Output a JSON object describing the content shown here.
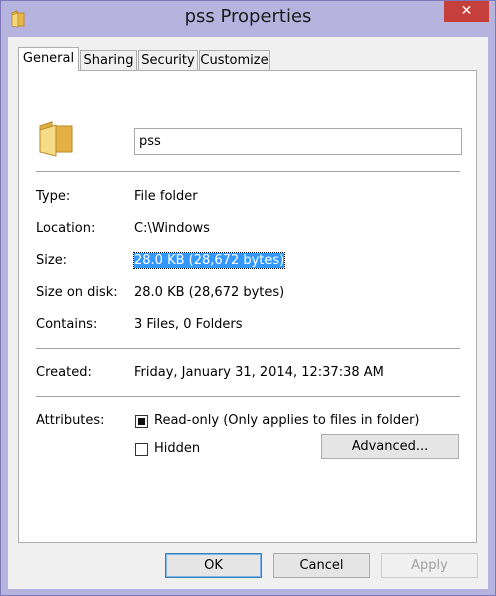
{
  "window": {
    "title": "pss Properties",
    "close_glyph": "✕"
  },
  "tabs": [
    {
      "label": "General",
      "active": true
    },
    {
      "label": "Sharing",
      "active": false
    },
    {
      "label": "Security",
      "active": false
    },
    {
      "label": "Customize",
      "active": false
    }
  ],
  "general": {
    "name_value": "pss",
    "type_label": "Type:",
    "type_value": "File folder",
    "location_label": "Location:",
    "location_value": "C:\\Windows",
    "size_label": "Size:",
    "size_value": "28.0 KB (28,672 bytes)",
    "size_on_disk_label": "Size on disk:",
    "size_on_disk_value": "28.0 KB (28,672 bytes)",
    "contains_label": "Contains:",
    "contains_value": "3 Files, 0 Folders",
    "created_label": "Created:",
    "created_value": "Friday, January 31, 2014, 12:37:38 AM",
    "attributes_label": "Attributes:",
    "readonly_label": "Read-only (Only applies to files in folder)",
    "hidden_label": "Hidden",
    "advanced_label": "Advanced..."
  },
  "footer": {
    "ok_label": "OK",
    "cancel_label": "Cancel",
    "apply_label": "Apply"
  },
  "colors": {
    "frame": "#b7b3df",
    "close": "#c5403a",
    "selection": "#3399ff"
  },
  "icons": {
    "title": "folder-icon",
    "large": "folder-icon"
  }
}
